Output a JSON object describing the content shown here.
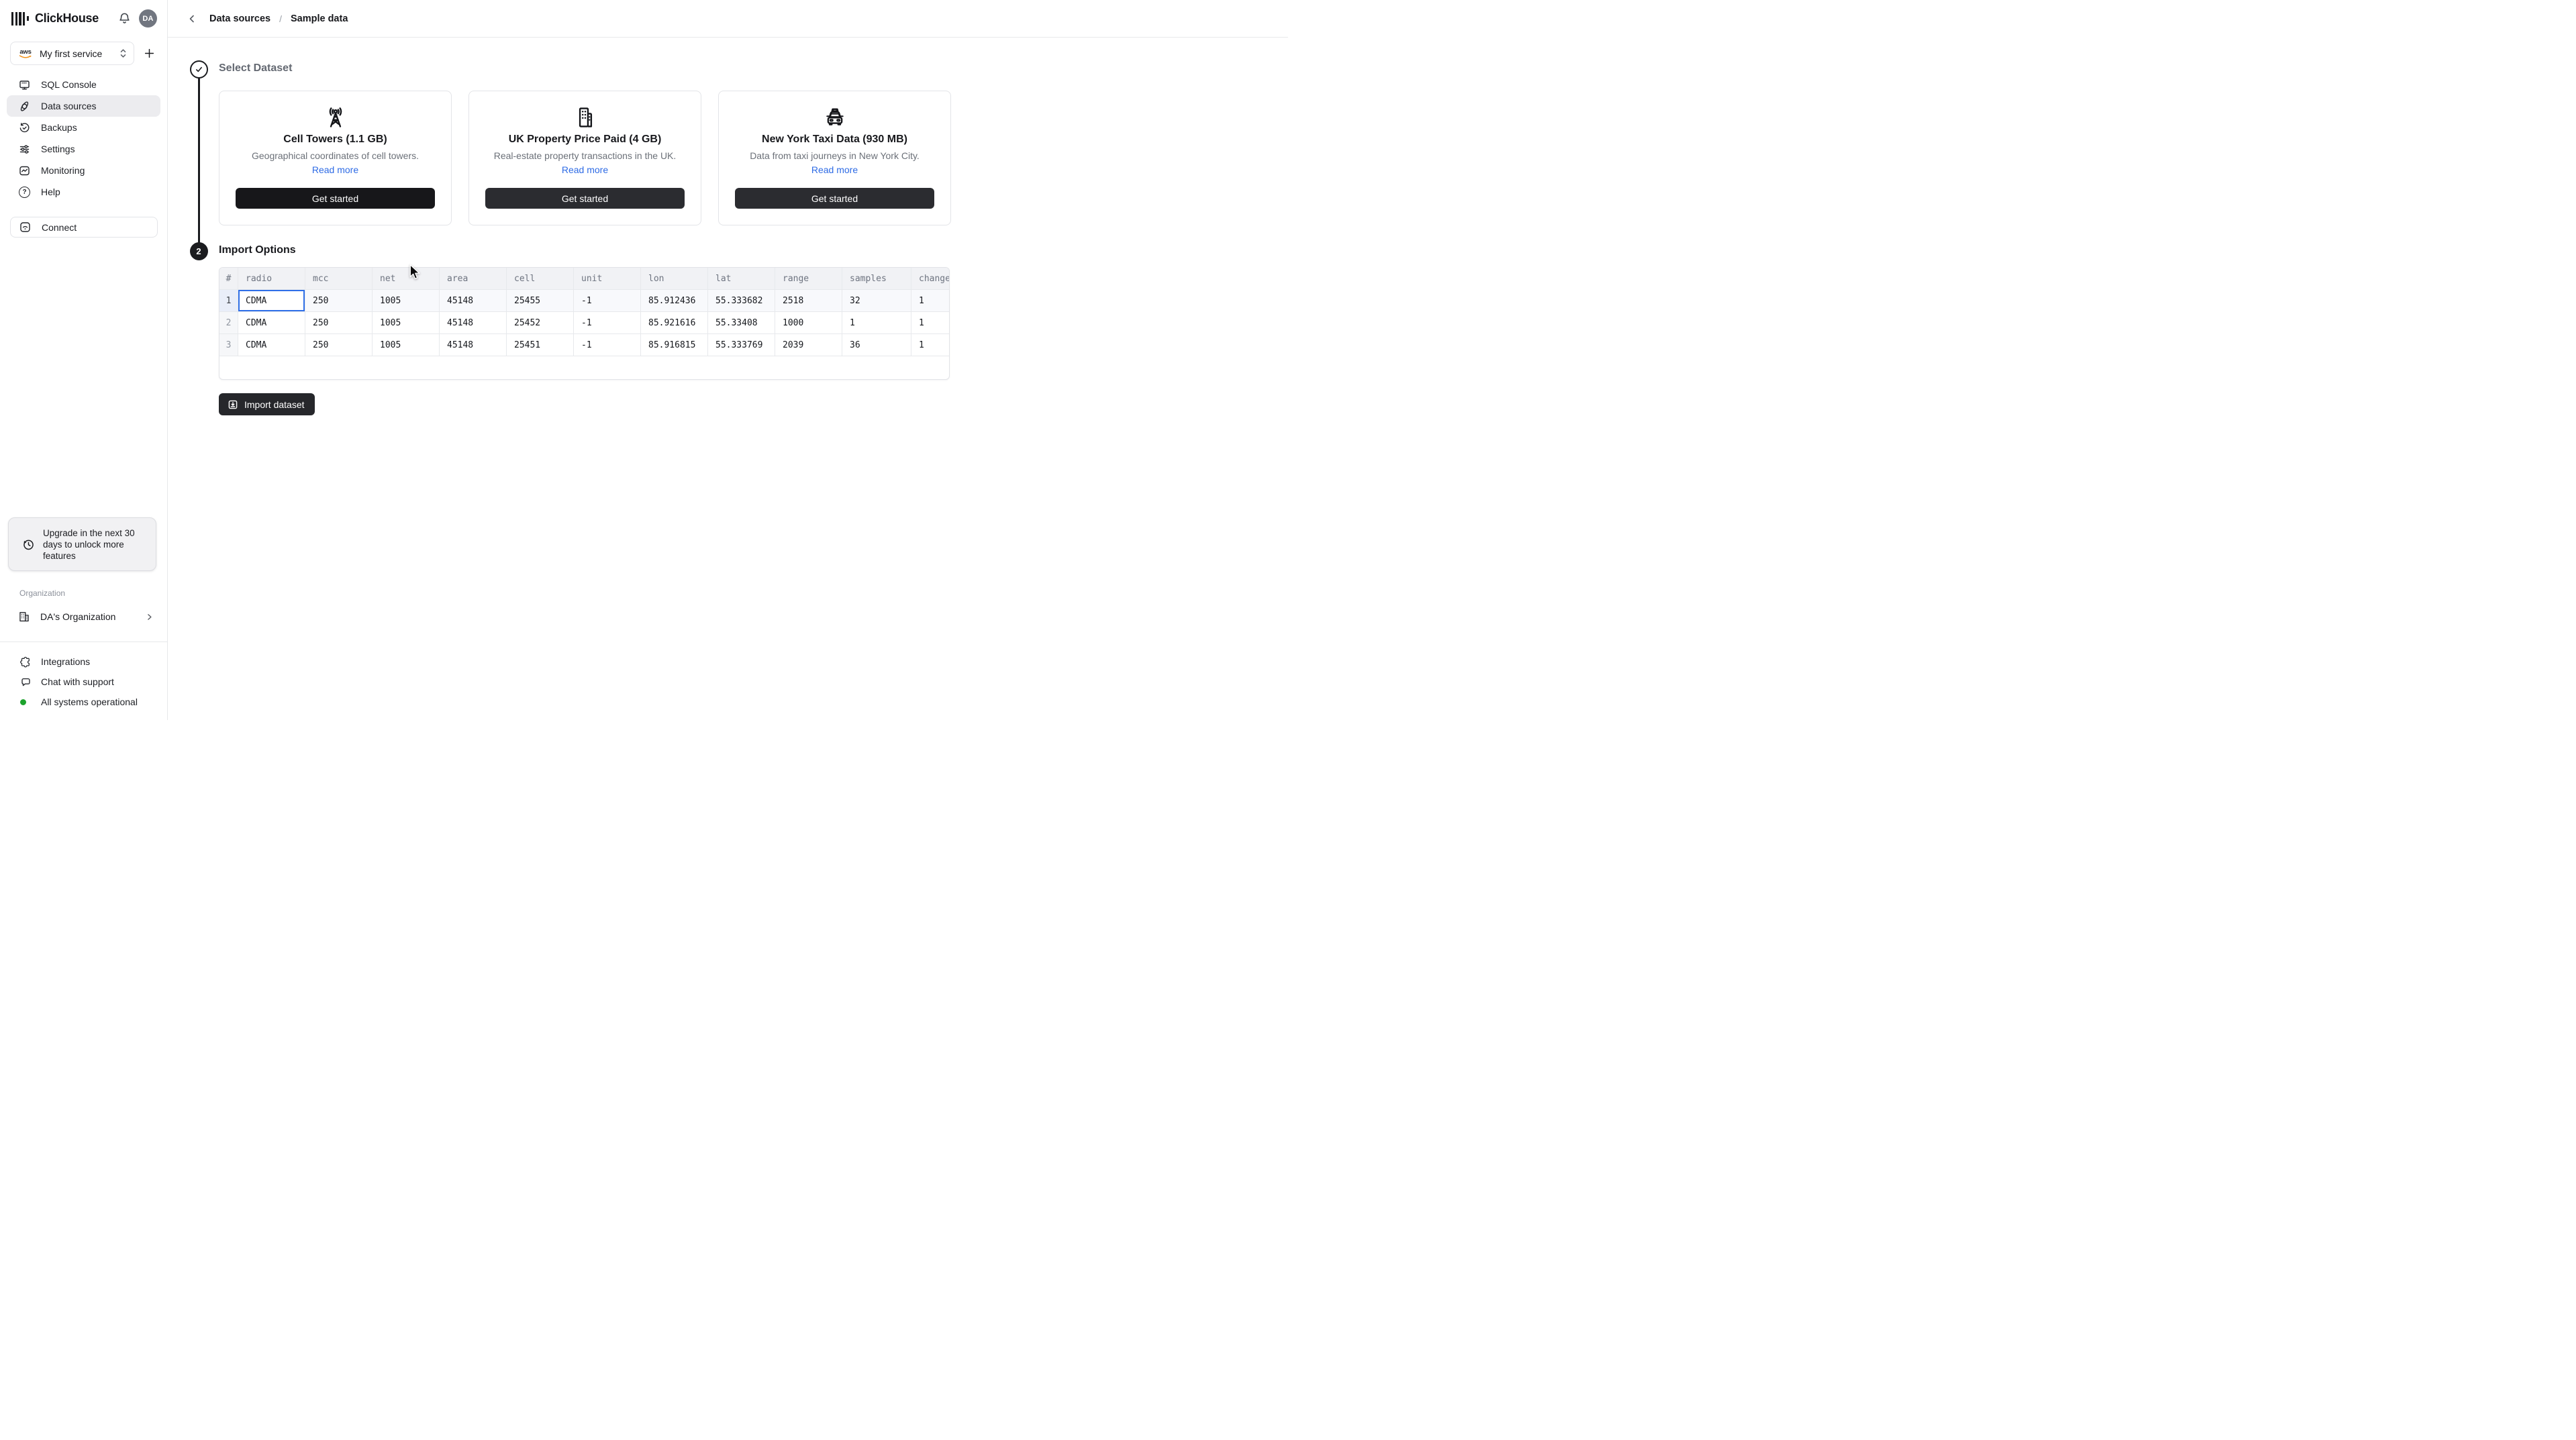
{
  "sidebar": {
    "brand": "ClickHouse",
    "avatar_initials": "DA",
    "service": {
      "provider": "aws",
      "name": "My first service"
    },
    "nav": [
      {
        "label": "SQL Console"
      },
      {
        "label": "Data sources"
      },
      {
        "label": "Backups"
      },
      {
        "label": "Settings"
      },
      {
        "label": "Monitoring"
      },
      {
        "label": "Help"
      }
    ],
    "connect_label": "Connect",
    "upgrade_notice": "Upgrade in the next 30 days to unlock more features",
    "org": {
      "section_label": "Organization",
      "name": "DA's Organization"
    },
    "footer": [
      {
        "label": "Integrations"
      },
      {
        "label": "Chat with support"
      },
      {
        "label": "All systems operational"
      }
    ]
  },
  "breadcrumb": {
    "section": "Data sources",
    "separator": "/",
    "page": "Sample data"
  },
  "steps": {
    "select_dataset": {
      "title": "Select Dataset"
    },
    "import_options": {
      "number": "2",
      "title": "Import Options"
    }
  },
  "datasets": [
    {
      "title": "Cell Towers (1.1 GB)",
      "description": "Geographical coordinates of cell towers.",
      "read_more": "Read more",
      "get_started": "Get started"
    },
    {
      "title": "UK Property Price Paid (4 GB)",
      "description": "Real-estate property transactions in the UK.",
      "read_more": "Read more",
      "get_started": "Get started"
    },
    {
      "title": "New York Taxi Data (930 MB)",
      "description": "Data from taxi journeys in New York City.",
      "read_more": "Read more",
      "get_started": "Get started"
    }
  ],
  "table": {
    "index_header": "#",
    "columns": [
      "radio",
      "mcc",
      "net",
      "area",
      "cell",
      "unit",
      "lon",
      "lat",
      "range",
      "samples",
      "changeable"
    ],
    "row_numbers": [
      "1",
      "2",
      "3"
    ],
    "rows": [
      [
        "CDMA",
        "250",
        "1005",
        "45148",
        "25455",
        "-1",
        "85.912436",
        "55.333682",
        "2518",
        "32",
        "1"
      ],
      [
        "CDMA",
        "250",
        "1005",
        "45148",
        "25452",
        "-1",
        "85.921616",
        "55.33408",
        "1000",
        "1",
        "1"
      ],
      [
        "CDMA",
        "250",
        "1005",
        "45148",
        "25451",
        "-1",
        "85.916815",
        "55.333769",
        "2039",
        "36",
        "1"
      ]
    ]
  },
  "import_button_label": "Import dataset",
  "colors": {
    "accent_blue": "#2f6fe8",
    "link_blue": "#2e6be5",
    "status_green": "#1ca32c",
    "dark_button": "#26272b"
  }
}
